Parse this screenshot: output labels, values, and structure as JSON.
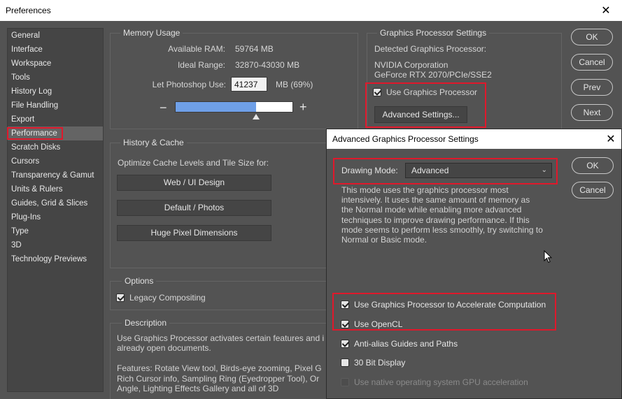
{
  "window": {
    "title": "Preferences",
    "close_glyph": "✕"
  },
  "sidebar": {
    "items": [
      {
        "label": "General"
      },
      {
        "label": "Interface"
      },
      {
        "label": "Workspace"
      },
      {
        "label": "Tools"
      },
      {
        "label": "History Log"
      },
      {
        "label": "File Handling"
      },
      {
        "label": "Export"
      },
      {
        "label": "Performance",
        "active": true
      },
      {
        "label": "Scratch Disks"
      },
      {
        "label": "Cursors"
      },
      {
        "label": "Transparency & Gamut"
      },
      {
        "label": "Units & Rulers"
      },
      {
        "label": "Guides, Grid & Slices"
      },
      {
        "label": "Plug-Ins"
      },
      {
        "label": "Type"
      },
      {
        "label": "3D"
      },
      {
        "label": "Technology Previews"
      }
    ]
  },
  "memory": {
    "title": "Memory Usage",
    "available_label": "Available RAM:",
    "available_value": "59764 MB",
    "ideal_label": "Ideal Range:",
    "ideal_value": "32870-43030 MB",
    "let_label": "Let Photoshop Use:",
    "let_value": "41237",
    "let_suffix": "MB (69%)",
    "minus": "−",
    "plus": "+",
    "slider_fraction": 0.69
  },
  "history_cache": {
    "title": "History & Cache",
    "optimize_label": "Optimize Cache Levels and Tile Size for:",
    "buttons": [
      "Web / UI Design",
      "Default / Photos",
      "Huge Pixel Dimensions"
    ]
  },
  "options": {
    "title": "Options",
    "legacy_label": "Legacy Compositing",
    "legacy_checked": true
  },
  "description": {
    "title": "Description",
    "line1": "Use Graphics Processor activates certain features and i",
    "line2": "already open documents.",
    "line3": "Features: Rotate View tool, Birds-eye zooming, Pixel G",
    "line4": "Rich Cursor info, Sampling Ring (Eyedropper Tool), Or",
    "line5": "Angle, Lighting Effects Gallery and all of 3D"
  },
  "gpu": {
    "title": "Graphics Processor Settings",
    "detected_label": "Detected Graphics Processor:",
    "vendor": "NVIDIA Corporation",
    "model": "GeForce RTX 2070/PCIe/SSE2",
    "use_gpu_label": "Use Graphics Processor",
    "use_gpu_checked": true,
    "advanced_button": "Advanced Settings..."
  },
  "main_buttons": {
    "ok": "OK",
    "cancel": "Cancel",
    "prev": "Prev",
    "next": "Next"
  },
  "advanced": {
    "title": "Advanced Graphics Processor Settings",
    "close_glyph": "✕",
    "drawing_mode_label": "Drawing Mode:",
    "drawing_mode_value": "Advanced",
    "desc_lines": [
      "This mode uses the graphics processor most",
      "intensively.  It uses the same amount of memory as",
      "the Normal mode while enabling more advanced",
      "techniques to improve drawing performance.  If this",
      "mode seems to perform less smoothly, try switching to",
      "Normal or Basic mode."
    ],
    "ok": "OK",
    "cancel": "Cancel",
    "options": [
      {
        "label": "Use Graphics Processor to Accelerate Computation",
        "checked": true,
        "disabled": false
      },
      {
        "label": "Use OpenCL",
        "checked": true,
        "disabled": false
      },
      {
        "label": "Anti-alias Guides and Paths",
        "checked": true,
        "disabled": false
      },
      {
        "label": "30 Bit Display",
        "checked": false,
        "disabled": false
      },
      {
        "label": "Use native operating system GPU acceleration",
        "checked": false,
        "disabled": true
      }
    ],
    "accent": "#e0182b"
  }
}
